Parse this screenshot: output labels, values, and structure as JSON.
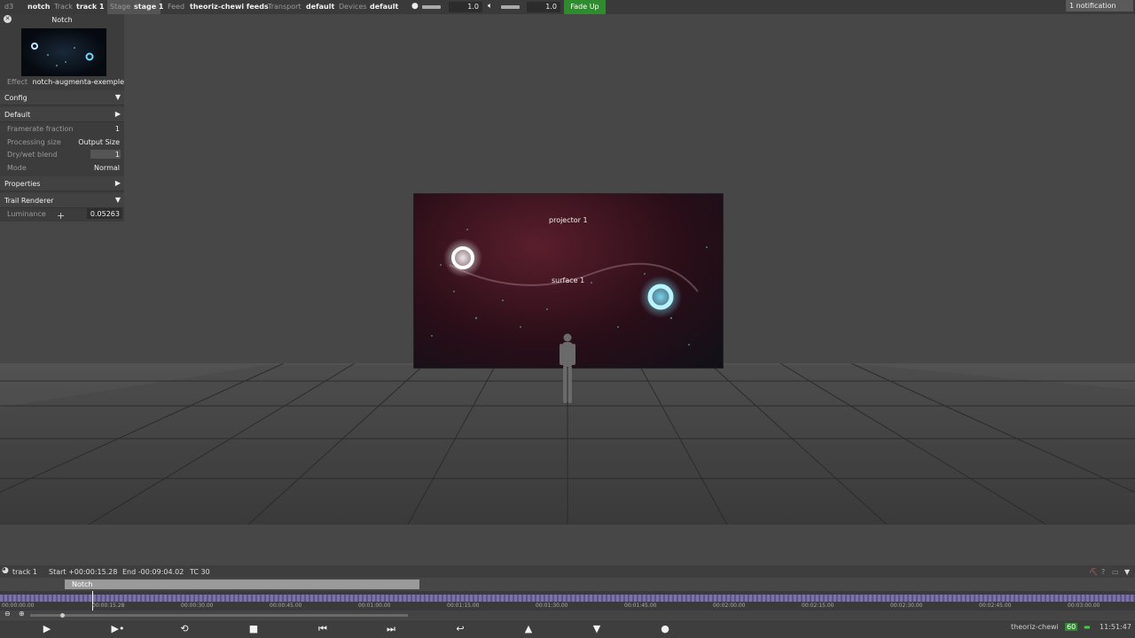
{
  "topbar": {
    "app": "d3",
    "project": "notch",
    "track_label": "Track",
    "track_value": "track 1",
    "stage_label": "Stage",
    "stage_value": "stage 1",
    "feed_label": "Feed",
    "feed_value": "theoriz-chewi feeds",
    "transport_label": "Transport",
    "transport_value": "default",
    "devices_label": "Devices",
    "devices_value": "default",
    "volume_value": "1.0",
    "brightness_value": "1.0",
    "fade_label": "Fade Up",
    "notification": "1 notification"
  },
  "panel": {
    "title": "Notch",
    "effect_label": "Effect",
    "effect_value": "notch-augmenta-exemple",
    "sections": {
      "config": "Config",
      "default": "Default",
      "properties": "Properties",
      "trail": "Trail Renderer"
    },
    "props": {
      "framerate_label": "Framerate fraction",
      "framerate_value": "1",
      "processing_label": "Processing size",
      "processing_value": "Output Size",
      "drywet_label": "Dry/wet blend",
      "drywet_value": "1",
      "mode_label": "Mode",
      "mode_value": "Normal",
      "luminance_label": "Luminance",
      "luminance_value": "0.05263"
    }
  },
  "viewport": {
    "projector_label": "projector 1",
    "surface_label": "surface 1"
  },
  "timeline": {
    "track_name": "track 1",
    "start": "Start +00:00:15.28",
    "end": "End -00:09:04.02",
    "tc": "TC 30",
    "clip_name": "Notch",
    "ticks": [
      "00:00:00.00",
      "00:00:15.28",
      "00:00:30.00",
      "00:00:45.00",
      "00:01:00.00",
      "00:01:15.00",
      "00:01:30.00",
      "00:01:45.00",
      "00:02:00.00",
      "00:02:15.00",
      "00:02:30.00",
      "00:02:45.00",
      "00:03:00.00"
    ]
  },
  "status": {
    "machine": "theoriz-chewi",
    "fps": "60",
    "clock": "11:51:47"
  },
  "colors": {
    "fade_up": "#2e8b2e",
    "fps_badge": "#2e8b2e"
  }
}
